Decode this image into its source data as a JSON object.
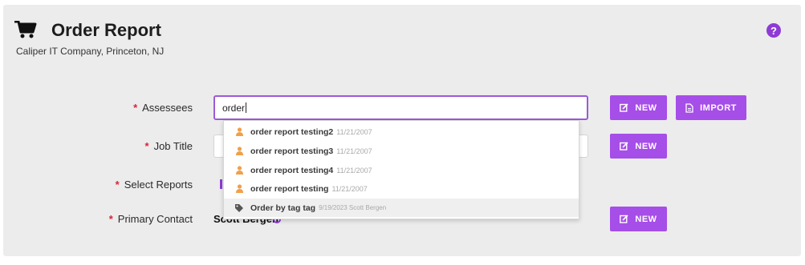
{
  "header": {
    "title": "Order Report",
    "subtitle": "Caliper IT Company, Princeton, NJ",
    "help_symbol": "?"
  },
  "form": {
    "required_marker": "*",
    "assessees": {
      "label": "Assessees",
      "value": "order"
    },
    "job_title": {
      "label": "Job Title",
      "value": ""
    },
    "select_reports": {
      "label": "Select Reports"
    },
    "primary_contact": {
      "label": "Primary Contact",
      "value": "Scott Bergen"
    }
  },
  "buttons": {
    "new_label": "NEW",
    "import_label": "IMPORT"
  },
  "autocomplete": [
    {
      "icon": "person-icon",
      "name": "order report testing2",
      "meta": "11/21/2007"
    },
    {
      "icon": "person-icon",
      "name": "order report testing3",
      "meta": "11/21/2007"
    },
    {
      "icon": "person-icon",
      "name": "order report testing4",
      "meta": "11/21/2007"
    },
    {
      "icon": "person-icon",
      "name": "order report testing",
      "meta": "11/21/2007"
    },
    {
      "icon": "tag-icon",
      "name": "Order by tag tag",
      "meta": "9/19/2023 Scott Bergen"
    }
  ],
  "colors": {
    "accent": "#a64ee8",
    "person_icon": "#f0a04b",
    "required": "#d8233a",
    "panel": "#ececec"
  }
}
